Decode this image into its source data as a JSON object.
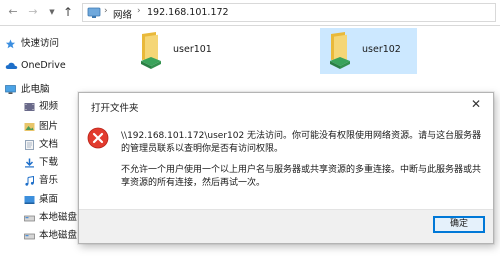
{
  "address_bar": {
    "crumbs": [
      "网络",
      "192.168.101.172"
    ]
  },
  "sidebar": {
    "items": [
      {
        "label": "快速访问",
        "icon": "star-icon"
      },
      {
        "label": "OneDrive",
        "icon": "cloud-icon"
      },
      {
        "label": "此电脑",
        "icon": "computer-icon"
      },
      {
        "label": "视频",
        "icon": "video-folder-icon"
      },
      {
        "label": "图片",
        "icon": "pictures-folder-icon"
      },
      {
        "label": "文档",
        "icon": "documents-folder-icon"
      },
      {
        "label": "下载",
        "icon": "downloads-folder-icon"
      },
      {
        "label": "音乐",
        "icon": "music-folder-icon"
      },
      {
        "label": "桌面",
        "icon": "desktop-folder-icon"
      },
      {
        "label": "本地磁盘",
        "icon": "drive-icon"
      },
      {
        "label": "本地磁盘",
        "icon": "drive-icon"
      }
    ]
  },
  "content": {
    "shares": [
      {
        "label": "user101",
        "selected": false
      },
      {
        "label": "user102",
        "selected": true
      }
    ]
  },
  "dialog": {
    "title": "打开文件夹",
    "message1": "\\\\192.168.101.172\\user102 无法访问。你可能没有权限使用网络资源。请与这台服务器的管理员联系以查明你是否有访问权限。",
    "message2": "不允许一个用户使用一个以上用户名与服务器或共享资源的多重连接。中断与此服务器或共享资源的所有连接，然后再试一次。",
    "ok_label": "确定"
  },
  "colors": {
    "accent": "#0078d7",
    "selection": "#cce8ff",
    "error": "#e81123"
  }
}
